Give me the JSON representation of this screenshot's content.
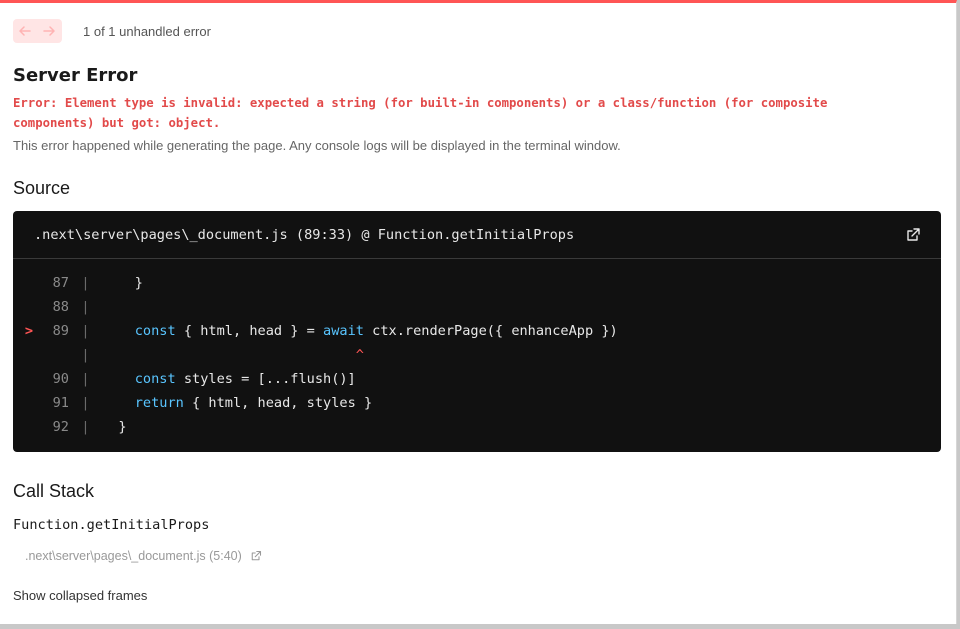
{
  "nav": {
    "prev_icon": "arrow-left-icon",
    "next_icon": "arrow-right-icon",
    "error_count": "1 of 1 unhandled error"
  },
  "error": {
    "title": "Server Error",
    "message": "Error: Element type is invalid: expected a string (for built-in components) or a class/function (for composite\ncomponents) but got: object.",
    "description": "This error happened while generating the page. Any console logs will be displayed in the terminal window."
  },
  "source": {
    "heading": "Source",
    "file": ".next\\server\\pages\\_document.js (89:33) @ Function.getInitialProps",
    "open_icon": "external-link-icon",
    "lines": [
      {
        "num": "87",
        "mark": "",
        "code": "    }"
      },
      {
        "num": "88",
        "mark": "",
        "code": ""
      },
      {
        "num": "89",
        "mark": ">",
        "code": "    const { html, head } = await ctx.renderPage({ enhanceApp })"
      },
      {
        "num": "",
        "mark": "",
        "code": "                               ^"
      },
      {
        "num": "90",
        "mark": "",
        "code": "    const styles = [...flush()]"
      },
      {
        "num": "91",
        "mark": "",
        "code": "    return { html, head, styles }"
      },
      {
        "num": "92",
        "mark": "",
        "code": "  }"
      }
    ]
  },
  "callstack": {
    "heading": "Call Stack",
    "frames": [
      {
        "function": "Function.getInitialProps",
        "location": ".next\\server\\pages\\_document.js (5:40)"
      }
    ],
    "show_collapsed": "Show collapsed frames"
  },
  "colors": {
    "accent": "#ff5555",
    "error_text": "#e24a4a",
    "keyword": "#59c5ff",
    "code_bg": "#111111"
  }
}
